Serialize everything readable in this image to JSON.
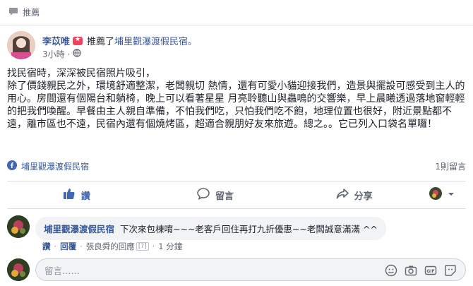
{
  "header": {
    "label": "推薦"
  },
  "post": {
    "author": "李苡唯",
    "action_text": "推薦了",
    "page_name": "埔里觀瀑渡假民宿。",
    "time": "3小時",
    "body": "找民宿時，深深被民宿照片吸引，\n除了價錢親民之外，環境舒適整潔，老闆親切 熱情，還有可愛小貓迎接我們，造景與擺設可感受到主人的用心。房間還有個陽台和躺椅，晚上可以看著星星 月亮聆聽山與蟲鳴的交響樂，早上晨曦透過落地窗輕輕的把我們喚醒。早餐由主人親自準備，不怕我們吃，只怕我們吃不飽，地理位置也很好，附近景點都不遠，離市區也不遠，民宿內還有個燒烤區，超適合親朋好友來旅遊。總之。。它已列入口袋名單囉！"
  },
  "reactions": {
    "page_link": "埔里觀瀑渡假民宿",
    "comment_count": "1則留言"
  },
  "actions": {
    "like": "讚",
    "comment": "留言",
    "share": "分享"
  },
  "comment": {
    "author": "埔里觀瀑渡假民宿",
    "text": "下次來包棟唷~~~老客戶回住再打九折優惠~~老闆誠意滿滿 ^^",
    "like": "讚",
    "reply": "回覆",
    "replied_by": "張良舜的回應",
    "help": "[?]",
    "time": "1 分鐘"
  },
  "composer": {
    "placeholder": "留言……"
  },
  "colors": {
    "link": "#385898",
    "like_blue": "#4267b2",
    "muted": "#606770"
  }
}
